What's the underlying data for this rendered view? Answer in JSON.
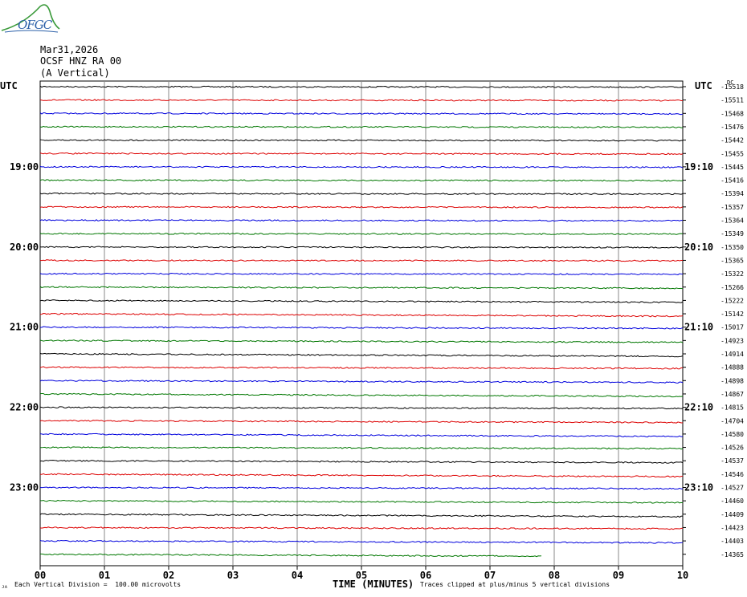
{
  "header": {
    "date": "Mar31,2026",
    "station": "OCSF HNZ RA 00",
    "component": "(A Vertical)"
  },
  "logo": {
    "text": "OFGC",
    "color": "#2a5fa8",
    "swoosh_color": "#3a9a3a"
  },
  "footer": {
    "division": "Each Vertical Division =  100.00 microvolts",
    "clip": "Traces clipped at plus/minus 5 vertical divisions",
    "corner": "ᴊᴧ"
  },
  "chart_data": {
    "type": "line",
    "title": "",
    "xlabel": "TIME (MINUTES)",
    "xlim": [
      0,
      10
    ],
    "x_ticks": [
      "00",
      "01",
      "02",
      "03",
      "04",
      "05",
      "06",
      "07",
      "08",
      "09",
      "10"
    ],
    "left_axis_label": "UTC",
    "right_axis_label": "UTC",
    "right_corner_label": "DC",
    "left_time_labels": [
      {
        "row": 6,
        "label": "19:00"
      },
      {
        "row": 12,
        "label": "20:00"
      },
      {
        "row": 18,
        "label": "21:00"
      },
      {
        "row": 24,
        "label": "22:00"
      },
      {
        "row": 30,
        "label": "23:00"
      }
    ],
    "right_time_labels": [
      {
        "row": 6,
        "label": "19:10"
      },
      {
        "row": 12,
        "label": "20:10"
      },
      {
        "row": 18,
        "label": "21:10"
      },
      {
        "row": 24,
        "label": "22:10"
      },
      {
        "row": 30,
        "label": "23:10"
      }
    ],
    "trace_colors": [
      "#000000",
      "#dd0000",
      "#0000dd",
      "#007700"
    ],
    "trace_count": 36,
    "dc_offsets": [
      -15518,
      -15511,
      -15468,
      -15476,
      -15442,
      -15455,
      -15445,
      -15416,
      -15394,
      -15357,
      -15364,
      -15349,
      -15350,
      -15365,
      -15322,
      -15266,
      -15222,
      -15142,
      -15017,
      -14923,
      -14914,
      -14888,
      -14898,
      -14867,
      -14815,
      -14704,
      -14580,
      -14526,
      -14537,
      -14546,
      -14527,
      -14460,
      -14409,
      -14423,
      -14403,
      -14365
    ],
    "last_trace_end_minute": 7.8,
    "grid": true
  }
}
